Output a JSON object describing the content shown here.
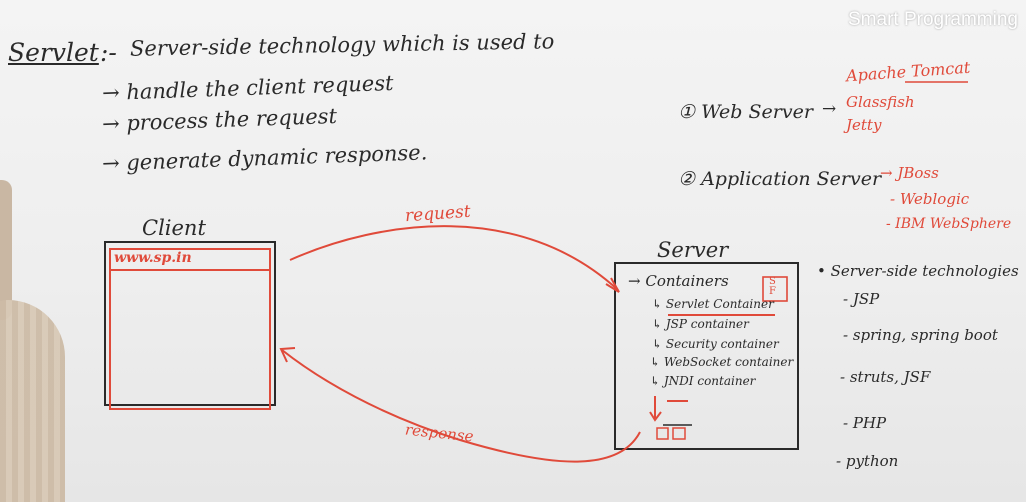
{
  "watermark": "Smart Programming",
  "title": {
    "term": "Servlet",
    "sep": ":-",
    "definition": "Server-side technology which is used to"
  },
  "bullets": [
    "→ handle the client request",
    "→ process the request",
    "→ generate dynamic response."
  ],
  "client": {
    "label": "Client",
    "url": "www.sp.in"
  },
  "arrows": {
    "request": "request",
    "response": "response"
  },
  "server": {
    "label": "Server",
    "containers": "→ Containers",
    "sf": "S\nF",
    "items": [
      "↳ Servlet Container",
      "↳ JSP container",
      "↳ Security container",
      "↳ WebSocket container",
      "↳ JNDI container"
    ]
  },
  "web_servers": {
    "label": "① Web Server",
    "items": [
      "Apache Tomcat",
      "Glassfish",
      "Jetty"
    ]
  },
  "app_servers": {
    "label": "② Application Server",
    "items": [
      "→ JBoss",
      "- Weblogic",
      "- IBM WebSphere"
    ]
  },
  "technologies": {
    "label": "• Server-side technologies",
    "items": [
      "- JSP",
      "- spring, spring boot",
      "- struts, JSF",
      "- PHP",
      "- python"
    ]
  },
  "colors": {
    "ink": "#2a2a2a",
    "red": "#e04a3a",
    "board": "#efefef"
  }
}
